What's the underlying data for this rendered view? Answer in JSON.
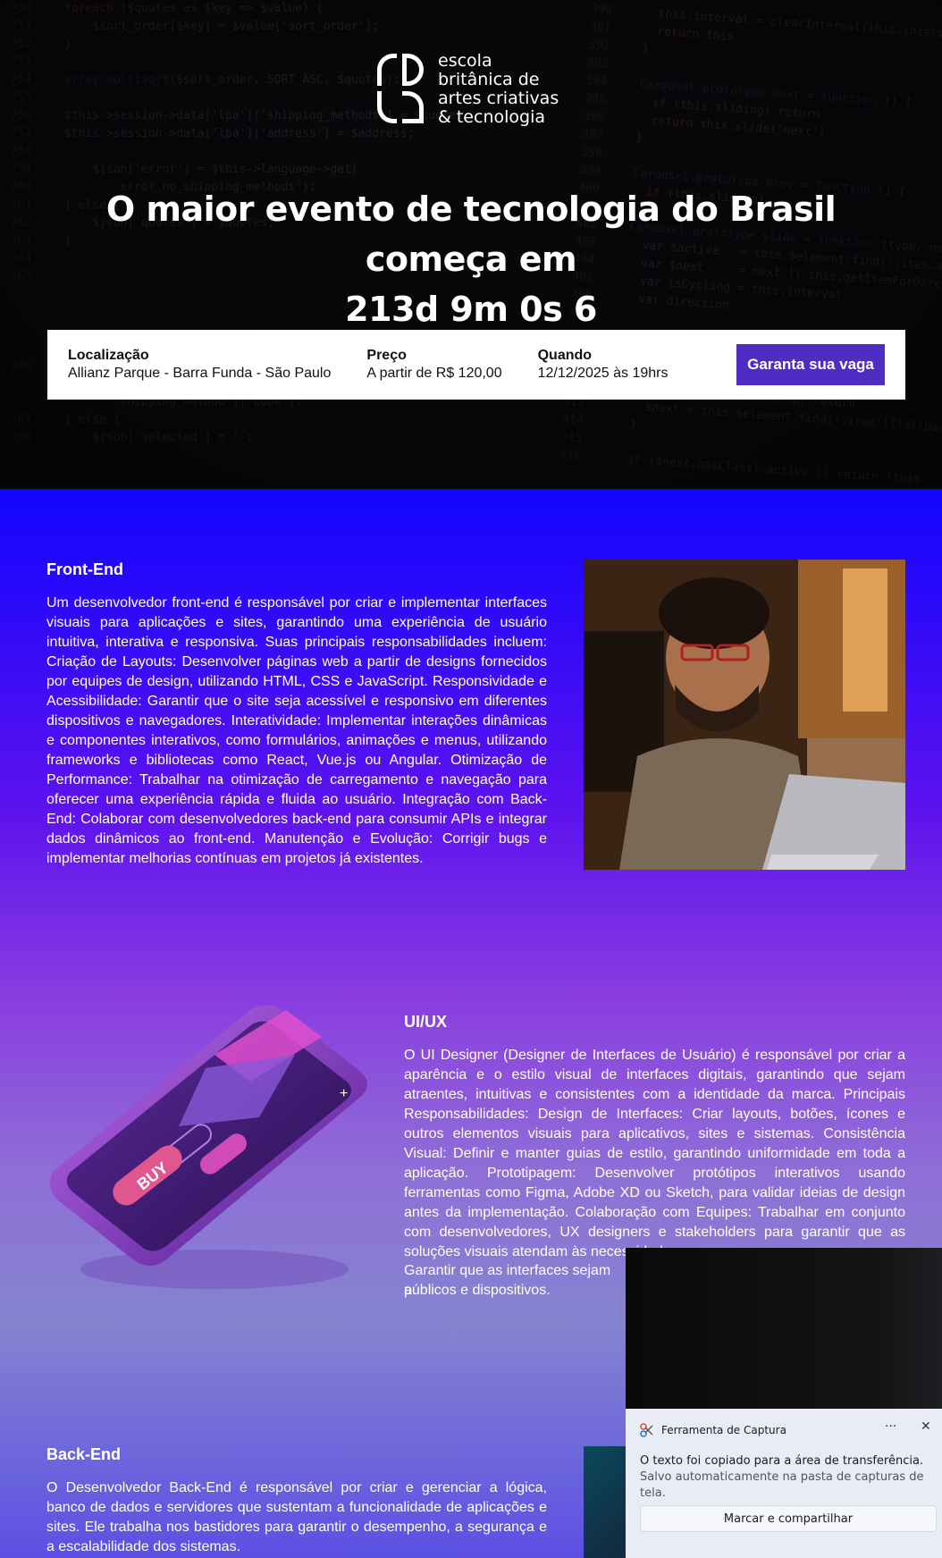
{
  "hero": {
    "logo_text": [
      "escola",
      "britânica de",
      "artes criativas",
      "& tecnologia"
    ],
    "headline_line1": "O maior evento de tecnologia do Brasil começa em",
    "headline_line2": "213d 9m 0s 6"
  },
  "infobar": {
    "location_title": "Localização",
    "location_value": "Allianz Parque - Barra Funda - São Paulo",
    "price_title": "Preço",
    "price_value": "A partir de R$ 120,00",
    "when_title": "Quando",
    "when_value": "12/12/2025 às 19hrs",
    "cta_label": "Garanta sua vaga"
  },
  "sections": {
    "frontend": {
      "title": "Front-End",
      "text": "Um desenvolvedor front-end é responsável por criar e implementar interfaces visuais para aplicações e sites, garantindo uma experiência de usuário intuitiva, interativa e responsiva. Suas principais responsabilidades incluem: Criação de Layouts: Desenvolver páginas web a partir de designs fornecidos por equipes de design, utilizando HTML, CSS e JavaScript. Responsividade e Acessibilidade: Garantir que o site seja acessível e responsivo em diferentes dispositivos e navegadores. Interatividade: Implementar interações dinâmicas e componentes interativos, como formulários, animações e menus, utilizando frameworks e bibliotecas como React, Vue.js ou Angular. Otimização de Performance: Trabalhar na otimização de carregamento e navegação para oferecer uma experiência rápida e fluida ao usuário. Integração com Back-End: Colaborar com desenvolvedores back-end para consumir APIs e integrar dados dinâmicos ao front-end. Manutenção e Evolução: Corrigir bugs e implementar melhorias contínuas em projetos já existentes."
    },
    "uiux": {
      "title": "UI/UX",
      "text": "O UI Designer (Designer de Interfaces de Usuário) é responsável por criar a aparência e o estilo visual de interfaces digitais, garantindo que sejam atraentes, intuitivas e consistentes com a identidade da marca. Principais Responsabilidades: Design de Interfaces: Criar layouts, botões, ícones e outros elementos visuais para aplicativos, sites e sistemas. Consistência Visual: Definir e manter guias de estilo, garantindo uniformidade em toda a aplicação. Prototipagem: Desenvolver protótipos interativos usando ferramentas como Figma, Adobe XD ou Sketch, para validar ideias de design antes da implementação. Colaboração com Equipes: Trabalhar em conjunto com desenvolvedores, UX designers e stakeholders para garantir que as soluções visuais atendam às necessidades",
      "text_end": "Garantir que as interfaces sejam a",
      "text_last": "públicos e dispositivos.",
      "phone_label": "BUY"
    },
    "backend": {
      "title": "Back-End",
      "text": "O Desenvolvedor Back-End é responsável por criar e gerenciar a lógica, banco de dados e servidores que sustentam a funcionalidade de aplicações e sites. Ele trabalha nos bastidores para garantir o desempenho, a segurança e a escalabilidade dos sistemas."
    }
  },
  "toast": {
    "app_name": "Ferramenta de Captura",
    "more": "···",
    "close": "✕",
    "message": "O texto foi copiado para a área de transferência.",
    "submessage": "Salvo automaticamente na pasta de capturas de tela.",
    "button": "Marcar e compartilhar"
  },
  "colors": {
    "cta": "#4f2dc4",
    "gradient_top": "#1205ff",
    "gradient_mid": "#8a3ee0"
  }
}
